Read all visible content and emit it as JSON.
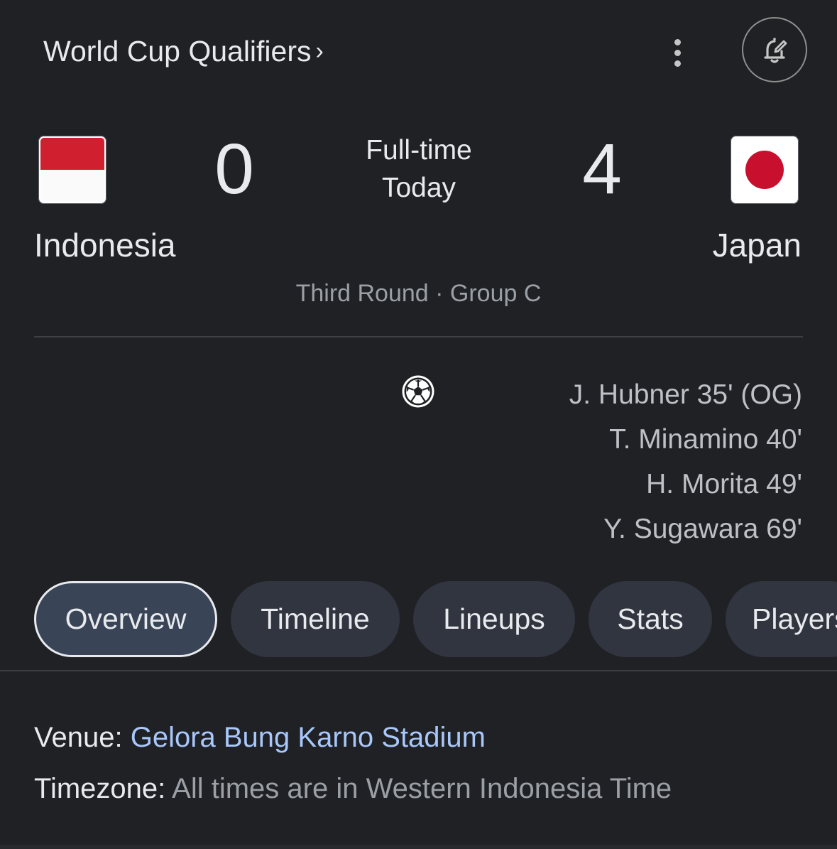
{
  "header": {
    "title": "World Cup Qualifiers",
    "chevron": "›",
    "more_icon": "more-vert-icon",
    "alert_icon": "bell-edit-icon"
  },
  "match": {
    "home": {
      "name": "Indonesia",
      "score": "0",
      "flag_icon": "indonesia-flag-icon",
      "flag_colors": [
        "#d0202f",
        "#fafafa"
      ]
    },
    "away": {
      "name": "Japan",
      "score": "4",
      "flag_icon": "japan-flag-icon",
      "flag_colors": [
        "#ffffff",
        "#c8102e"
      ]
    },
    "status": "Full-time",
    "date": "Today",
    "round": "Third Round · Group C"
  },
  "goals": {
    "icon": "soccer-ball-icon",
    "away_scorers": [
      "J. Hubner 35' (OG)",
      "T. Minamino 40'",
      "H. Morita 49'",
      "Y. Sugawara 69'"
    ]
  },
  "tabs": [
    {
      "label": "Overview",
      "active": true
    },
    {
      "label": "Timeline",
      "active": false
    },
    {
      "label": "Lineups",
      "active": false
    },
    {
      "label": "Stats",
      "active": false
    },
    {
      "label": "Players",
      "active": false
    }
  ],
  "info": {
    "venue_label": "Venue:",
    "venue_value": "Gelora Bung Karno Stadium",
    "timezone_label": "Timezone:",
    "timezone_value": "All times are in Western Indonesia Time"
  },
  "colors": {
    "background": "#202124",
    "link": "#a8c7fa",
    "tab_bg": "#303540",
    "tab_active_bg": "#394457"
  }
}
